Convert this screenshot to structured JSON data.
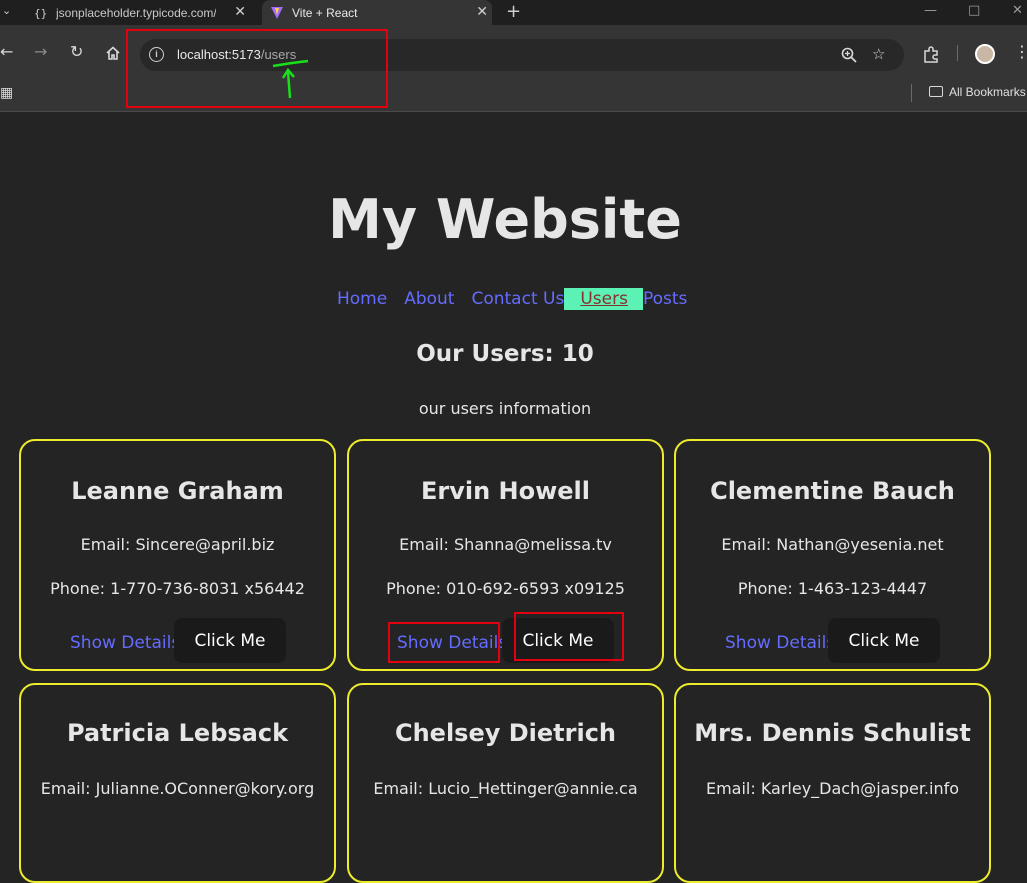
{
  "browser": {
    "tabs": [
      {
        "title": "jsonplaceholder.typicode.com/p",
        "active": false
      },
      {
        "title": "Vite + React",
        "active": true
      }
    ],
    "url_host": "localhost:5173",
    "url_path": "/users",
    "bookmarks_label": "All Bookmarks"
  },
  "site": {
    "title": "My Website",
    "nav": [
      "Home",
      "About",
      "Contact Us",
      "Users",
      "Posts"
    ],
    "active_nav": "Users",
    "users_heading": "Our Users: 10",
    "users_subtitle": "our users information"
  },
  "users": [
    {
      "name": "Leanne Graham",
      "email": "Email: Sincere@april.biz",
      "phone": "Phone: 1-770-736-8031 x56442",
      "show_label": "Show Details",
      "button_label": "Click Me"
    },
    {
      "name": "Ervin Howell",
      "email": "Email: Shanna@melissa.tv",
      "phone": "Phone: 010-692-6593 x09125",
      "show_label": "Show Details",
      "button_label": "Click Me"
    },
    {
      "name": "Clementine Bauch",
      "email": "Email: Nathan@yesenia.net",
      "phone": "Phone: 1-463-123-4447",
      "show_label": "Show Details",
      "button_label": "Click Me"
    },
    {
      "name": "Patricia Lebsack",
      "email": "Email: Julianne.OConner@kory.org"
    },
    {
      "name": "Chelsey Dietrich",
      "email": "Email: Lucio_Hettinger@annie.ca"
    },
    {
      "name": "Mrs. Dennis Schulist",
      "email": "Email: Karley_Dach@jasper.info"
    }
  ],
  "colors": {
    "page_bg": "#242424",
    "link": "#646cff",
    "card_border": "#ecec2c",
    "active_nav_bg": "#5cf2b5",
    "annotation": "#e3000f"
  }
}
